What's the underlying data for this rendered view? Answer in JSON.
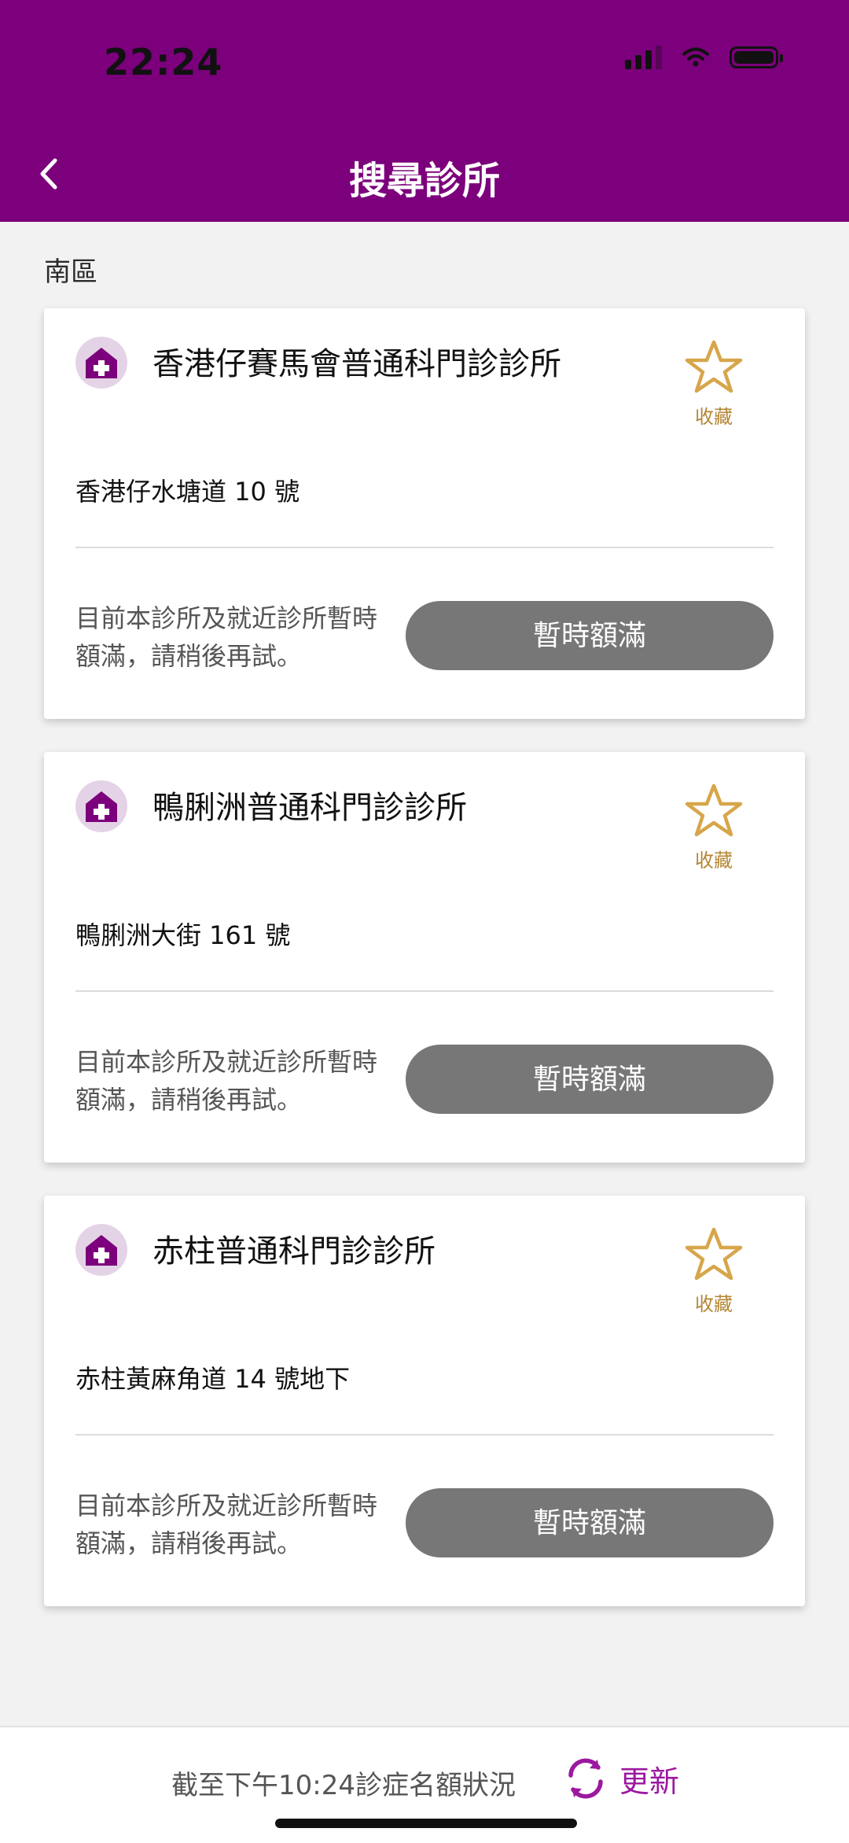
{
  "status_bar": {
    "time": "22:24",
    "signal_icon": "signal-icon",
    "wifi_icon": "wifi-icon",
    "battery_icon": "battery-icon"
  },
  "header": {
    "title": "搜尋診所",
    "back_icon": "chevron-left-icon",
    "background_color": "#7c007c"
  },
  "section": {
    "label": "南區"
  },
  "clinics": [
    {
      "name": "香港仔賽馬會普通科門診診所",
      "address": "香港仔水塘道 10 號",
      "favorite_label": "收藏",
      "status_text": "目前本診所及就近診所暫時額滿，請稍後再試。",
      "button_label": "暫時額滿"
    },
    {
      "name": "鴨脷洲普通科門診診所",
      "address": "鴨脷洲大街 161 號",
      "favorite_label": "收藏",
      "status_text": "目前本診所及就近診所暫時額滿，請稍後再試。",
      "button_label": "暫時額滿"
    },
    {
      "name": "赤柱普通科門診診所",
      "address": "赤柱黃麻角道 14 號地下",
      "favorite_label": "收藏",
      "status_text": "目前本診所及就近診所暫時額滿，請稍後再試。",
      "button_label": "暫時額滿"
    }
  ],
  "footer": {
    "status_text": "截至下午10:24診症名額狀況",
    "refresh_label": "更新",
    "refresh_icon": "refresh-icon"
  },
  "colors": {
    "accent": "#7c007c",
    "favorite": "#d7a64b",
    "button_disabled": "#777777",
    "refresh": "#9c18a0"
  }
}
